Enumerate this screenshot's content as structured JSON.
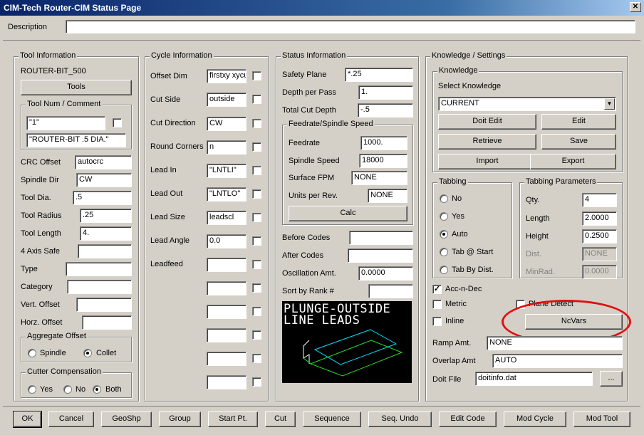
{
  "window": {
    "title": "CIM-Tech Router-CIM Status Page",
    "close": "✕"
  },
  "description": {
    "label": "Description",
    "value": ""
  },
  "tool_info": {
    "title": "Tool Information",
    "tool_name": "ROUTER-BIT_500",
    "tools_button": "Tools",
    "num_comment": {
      "title": "Tool Num / Comment",
      "num": "\"1\"",
      "comment": "\"ROUTER-BIT .5 DIA.\""
    },
    "fields": [
      {
        "label": "CRC Offset",
        "value": "autocrc"
      },
      {
        "label": "Spindle Dir",
        "value": "CW"
      },
      {
        "label": "Tool Dia.",
        "value": ".5"
      },
      {
        "label": "Tool Radius",
        "value": ".25"
      },
      {
        "label": "Tool Length",
        "value": "4."
      },
      {
        "label": "4 Axis Safe",
        "value": ""
      },
      {
        "label": "Type",
        "value": ""
      },
      {
        "label": "Category",
        "value": ""
      },
      {
        "label": "Vert. Offset",
        "value": ""
      },
      {
        "label": "Horz. Offset",
        "value": ""
      }
    ],
    "aggregate": {
      "title": "Aggregate Offset",
      "options": [
        "Spindle",
        "Collet"
      ],
      "selected": "Collet"
    },
    "cutter_comp": {
      "title": "Cutter Compensation",
      "options": [
        "Yes",
        "No",
        "Both"
      ],
      "selected": "Both"
    }
  },
  "cycle_info": {
    "title": "Cycle Information",
    "fields": [
      {
        "label": "Offset Dim",
        "value": "firstxy xycu"
      },
      {
        "label": "Cut Side",
        "value": "outside"
      },
      {
        "label": "Cut Direction",
        "value": "CW"
      },
      {
        "label": "Round Corners",
        "value": "n"
      },
      {
        "label": "Lead In",
        "value": "\"LNTLI\""
      },
      {
        "label": "Lead Out",
        "value": "\"LNTLO\""
      },
      {
        "label": "Lead Size",
        "value": "leadscl"
      },
      {
        "label": "Lead Angle",
        "value": "0.0"
      },
      {
        "label": "Leadfeed",
        "value": ""
      }
    ],
    "extra_rows": [
      "",
      "",
      "",
      "",
      "",
      ""
    ]
  },
  "status_info": {
    "title": "Status Information",
    "fields": [
      {
        "label": "Safety Plane",
        "value": "*.25"
      },
      {
        "label": "Depth per Pass",
        "value": "1."
      },
      {
        "label": "Total Cut Depth",
        "value": "-.5"
      }
    ],
    "feed": {
      "title": "Feedrate/Spindle Speed",
      "fields": [
        {
          "label": "Feedrate",
          "value": "1000."
        },
        {
          "label": "Spindle Speed",
          "value": "18000"
        },
        {
          "label": "Surface FPM",
          "value": "NONE"
        },
        {
          "label": "Units per Rev.",
          "value": "NONE"
        }
      ],
      "calc_button": "Calc"
    },
    "fields2": [
      {
        "label": "Before Codes",
        "value": ""
      },
      {
        "label": "After Codes",
        "value": ""
      },
      {
        "label": "Oscillation Amt.",
        "value": "0.0000"
      },
      {
        "label": "Sort by Rank #",
        "value": ""
      }
    ],
    "preview": {
      "line1": "PLUNGE-OUTSIDE",
      "line2": "LINE LEADS"
    }
  },
  "knowledge": {
    "title": "Knowledge / Settings",
    "sub_title": "Knowledge",
    "select_label": "Select Knowledge",
    "selected": "CURRENT",
    "buttons": [
      "Doit Edit",
      "Edit",
      "Retrieve",
      "Save",
      "Import",
      "Export"
    ],
    "tabbing": {
      "title": "Tabbing",
      "options": [
        "No",
        "Yes",
        "Auto",
        "Tab @ Start",
        "Tab By Dist."
      ],
      "selected": "Auto"
    },
    "tab_params": {
      "title": "Tabbing Parameters",
      "fields": [
        {
          "label": "Qty.",
          "value": "4"
        },
        {
          "label": "Length",
          "value": "2.0000"
        },
        {
          "label": "Height",
          "value": "0.2500"
        },
        {
          "label": "Dist.",
          "value": "NONE"
        },
        {
          "label": "MinRad.",
          "value": "0.0000"
        }
      ]
    },
    "checks": [
      {
        "label": "Acc-n-Dec",
        "checked": true
      },
      {
        "label": "Metric",
        "checked": false
      },
      {
        "label": "Inline",
        "checked": false
      },
      {
        "label": "Plane Detect",
        "checked": false
      }
    ],
    "ncvars_button": "NcVars",
    "ramp": {
      "label": "Ramp Amt.",
      "value": "NONE"
    },
    "overlap": {
      "label": "Overlap Amt",
      "value": "AUTO"
    },
    "doit": {
      "label": "Doit File",
      "value": "doitinfo.dat",
      "browse": "..."
    }
  },
  "bottom_buttons": [
    "OK",
    "Cancel",
    "GeoShp",
    "Group",
    "Start Pt.",
    "Cut",
    "Sequence",
    "Seq. Undo",
    "Edit Code",
    "Mod Cycle",
    "Mod Tool"
  ],
  "colors": {
    "face": "#d4d0c8",
    "title_start": "#0a246a",
    "highlight": "#e01010",
    "preview_cyan": "#00e0ff",
    "preview_green": "#20e020"
  }
}
